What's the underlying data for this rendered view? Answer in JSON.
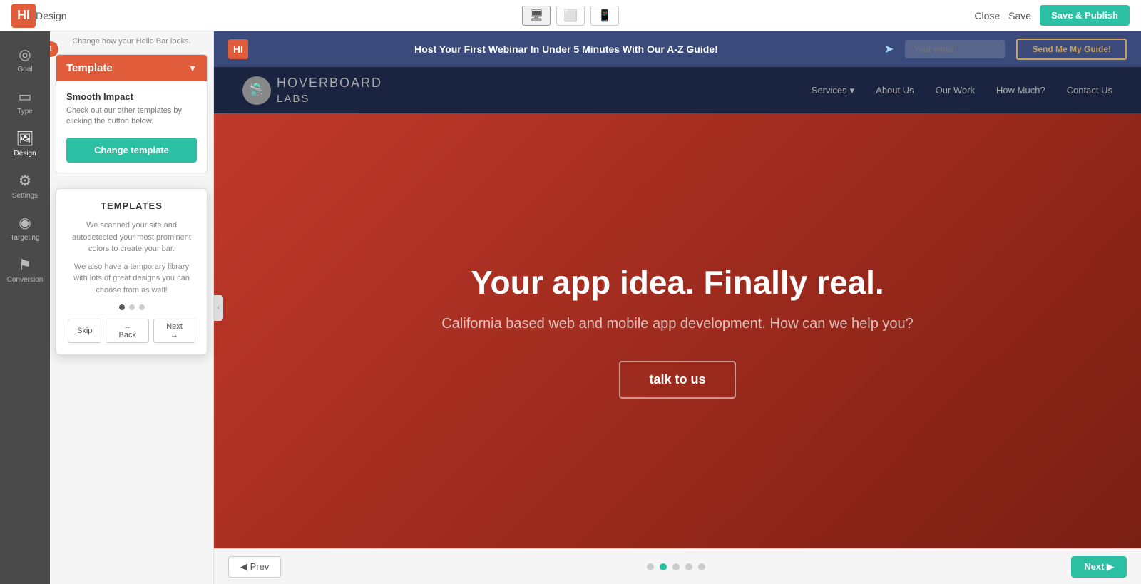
{
  "topbar": {
    "title": "Design",
    "subtitle": "Change how your Hello Bar looks.",
    "close_label": "Close",
    "save_label": "Save",
    "save_publish_label": "Save & Publish",
    "logo_text": "HI"
  },
  "devices": [
    {
      "name": "desktop",
      "icon": "🖥",
      "active": true
    },
    {
      "name": "tablet",
      "icon": "⬜",
      "active": false
    },
    {
      "name": "mobile",
      "icon": "📱",
      "active": false
    }
  ],
  "sidebar": {
    "items": [
      {
        "id": "goal",
        "label": "Goal",
        "icon": "◎"
      },
      {
        "id": "type",
        "label": "Type",
        "icon": "▭"
      },
      {
        "id": "design",
        "label": "Design",
        "icon": "🖼",
        "active": true
      },
      {
        "id": "settings",
        "label": "Settings",
        "icon": "⚙"
      },
      {
        "id": "targeting",
        "label": "Targeting",
        "icon": "◉"
      },
      {
        "id": "conversion",
        "label": "Conversion",
        "icon": "⚑"
      }
    ]
  },
  "template_panel": {
    "header_label": "Template",
    "name": "Smooth Impact",
    "description": "Check out our other templates by clicking the button below.",
    "change_button_label": "Change template",
    "badge": "1"
  },
  "tooltip": {
    "title": "TEMPLATES",
    "text1": "We scanned your site and autodetected your most prominent colors to create your bar.",
    "text2": "We also have a temporary library with lots of great designs you can choose from as well!",
    "dots": [
      {
        "active": true
      },
      {
        "active": false
      },
      {
        "active": false
      }
    ],
    "skip_label": "Skip",
    "back_label": "← Back",
    "next_label": "Next →"
  },
  "hellobar": {
    "logo": "HI",
    "text": "Host Your First Webinar In Under 5 Minutes With Our A-Z Guide!",
    "email_placeholder": "Your email",
    "button_label": "Send Me My Guide!"
  },
  "site": {
    "logo_text": "HOVERBOARD",
    "logo_sub": "LABS",
    "nav_items": [
      {
        "label": "Services",
        "has_dropdown": true
      },
      {
        "label": "About Us"
      },
      {
        "label": "Our Work"
      },
      {
        "label": "How Much?"
      },
      {
        "label": "Contact Us"
      }
    ],
    "hero_title": "Your app idea. Finally real.",
    "hero_subtitle": "California based web and mobile app development. How can we help you?",
    "hero_btn": "talk to us"
  },
  "bottom": {
    "prev_label": "◀ Prev",
    "next_label": "Next ▶",
    "dots": [
      {
        "active": false
      },
      {
        "active": true
      },
      {
        "active": false
      },
      {
        "active": false
      },
      {
        "active": false
      }
    ]
  }
}
